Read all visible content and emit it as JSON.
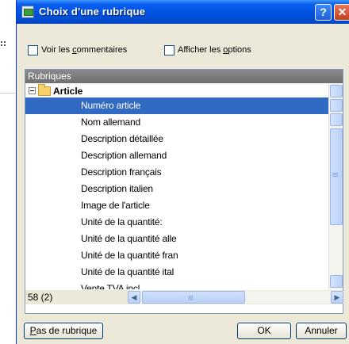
{
  "window": {
    "title": "Choix d'une rubrique",
    "help_label": "?",
    "close_label": "✕"
  },
  "options": {
    "show_comments": {
      "label_pre": "Voir les ",
      "label_access": "c",
      "label_post": "ommentaires",
      "checked": false
    },
    "show_options": {
      "label_pre": "Afficher les ",
      "label_access": "o",
      "label_post": "ptions",
      "checked": false
    }
  },
  "panel": {
    "header": "Rubriques",
    "root": {
      "label": "Article",
      "expanded": true
    },
    "items": [
      {
        "label": "Numéro article",
        "selected": true
      },
      {
        "label": "Nom allemand",
        "selected": false
      },
      {
        "label": "Description détaillée",
        "selected": false
      },
      {
        "label": "Description allemand",
        "selected": false
      },
      {
        "label": "Description français",
        "selected": false
      },
      {
        "label": "Description italien",
        "selected": false
      },
      {
        "label": "Image de l'article",
        "selected": false
      },
      {
        "label": "Unité de la quantité:",
        "selected": false
      },
      {
        "label": "Unité de la quantité alle",
        "selected": false
      },
      {
        "label": "Unité de la quantité fran",
        "selected": false
      },
      {
        "label": "Unité de la quantité ital",
        "selected": false
      },
      {
        "label": "Vente TVA incl.",
        "selected": false
      }
    ],
    "count_text": "58 (2)"
  },
  "buttons": {
    "no_rubric": {
      "label_access": "P",
      "label_post": "as de rubrique"
    },
    "ok": "OK",
    "cancel": "Annuler"
  },
  "colors": {
    "selection": "#316ac5",
    "titlebar": "#0052e0",
    "dialog_bg": "#ece9d8",
    "panel_header": "#7a7a7a"
  }
}
